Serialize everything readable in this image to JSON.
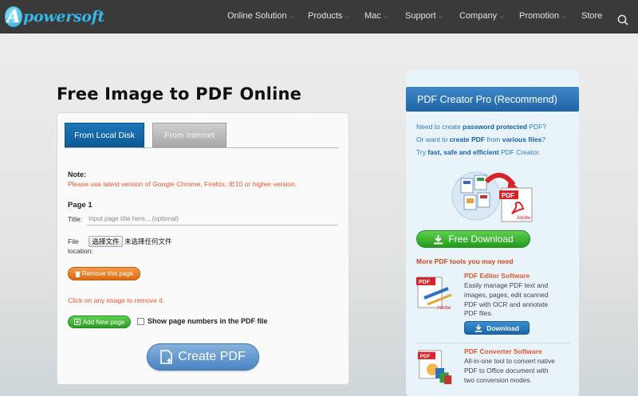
{
  "brand": {
    "logo_letter": "A",
    "logo_text": "powersoft"
  },
  "nav": {
    "items": [
      {
        "label": "Online Solution",
        "dropdown": true
      },
      {
        "label": "Products",
        "dropdown": true
      },
      {
        "label": "Mac",
        "dropdown": true
      },
      {
        "label": "Support",
        "dropdown": true
      },
      {
        "label": "Company",
        "dropdown": true
      },
      {
        "label": "Promotion",
        "dropdown": true
      },
      {
        "label": "Store",
        "dropdown": false
      }
    ],
    "chevron": "⌵",
    "search_icon": "search-icon"
  },
  "main": {
    "title": "Free Image to PDF Online",
    "tabs": [
      {
        "label": "From Local Disk",
        "active": true
      },
      {
        "label": "From Internet",
        "active": false
      }
    ],
    "note_label": "Note:",
    "note_text": "Please use latest version of Google Chrome, Firefox, IE10 or higher version.",
    "page_label": "Page 1",
    "title_field_label": "Title:",
    "title_placeholder": "Input page title here... (optional)",
    "file_label": "File location:",
    "file_button": "选择文件",
    "file_status": "未选择任何文件",
    "remove_button": "Remove this page",
    "click_hint": "Click on any image to remove it.",
    "add_button": "Add New page",
    "show_numbers_label": "Show page numbers in the PDF file",
    "show_numbers_checked": false,
    "create_button": "Create PDF"
  },
  "sidebar": {
    "header": "PDF Creator Pro (Recommend)",
    "lines": [
      {
        "pre": "Need to create ",
        "bold": "password protected",
        "post": " PDF?"
      },
      {
        "pre": "Or want to ",
        "bold": "create PDF",
        "mid": " from ",
        "bold2": "various files",
        "post": "?"
      },
      {
        "pre": "Try ",
        "bold": "fast, safe and efficient",
        "post": " PDF Creator."
      }
    ],
    "free_download": "Free Download",
    "more_title": "More PDF tools you may need",
    "products": [
      {
        "title": "PDF Editor Software",
        "description": "Easily manage PDF text and images, pages, edit scanned PDF with OCR and annotate PDF files.",
        "button": "Download"
      },
      {
        "title": "PDF Converter Software",
        "description": "All-in-one tool to convert native PDF to Office document with two conversion modes."
      }
    ]
  },
  "colors": {
    "topbar": "#3a3a3a",
    "accent_blue": "#1e76b8",
    "orange": "#e2572d",
    "green": "#2c9e23",
    "sidebar_bg": "#e8f4fa"
  }
}
